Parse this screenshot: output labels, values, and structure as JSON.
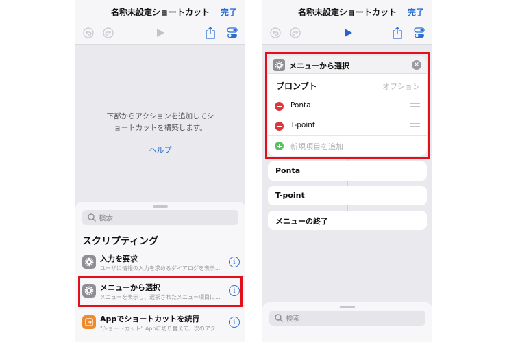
{
  "left": {
    "title": "名称未設定ショートカット",
    "done_label": "完了",
    "empty_message": "下部からアクションを追加してシ\nョートカットを構築します。",
    "help_link": "ヘルプ",
    "search_placeholder": "検索",
    "section_title": "スクリプティング",
    "actions": [
      {
        "title": "入力を要求",
        "desc": "ユーザに情報の入力を求めるダイアログを表示...",
        "icon": "gear-icon"
      },
      {
        "title": "メニューから選択",
        "desc": "メニューを表示し、選択されたメニュー項目に...",
        "icon": "gear-icon"
      },
      {
        "title": "Appでショートカットを続行",
        "desc": "\"ショートカット\" Appに切り替えて、次のアク...",
        "icon": "app-exit-icon"
      }
    ]
  },
  "right": {
    "title": "名称未設定ショートカット",
    "done_label": "完了",
    "menu_title": "メニューから選択",
    "prompt_label": "プロンプト",
    "prompt_placeholder": "オプション",
    "items": [
      "Ponta",
      "T-point"
    ],
    "add_item_label": "新規項目を追加",
    "blocks": [
      "Ponta",
      "T-point",
      "メニューの終了"
    ],
    "search_placeholder": "検索"
  },
  "colors": {
    "accent": "#2a6fd6",
    "highlight": "#e2101a",
    "remove": "#e0353a",
    "add": "#55c25e"
  }
}
